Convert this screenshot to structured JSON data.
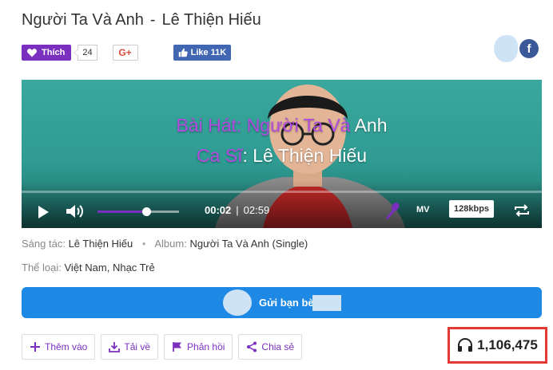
{
  "song": {
    "title": "Người Ta Và Anh",
    "separator": "-",
    "artist": "Lê Thiện Hiếu"
  },
  "social": {
    "like_label": "Thích",
    "like_count": "24",
    "gplus_label": "G+",
    "fb_like_label": "Like 11K",
    "fb_icon": "f"
  },
  "player": {
    "lyric_line1_highlight": "Bài Hát: Người Ta Và",
    "lyric_line1_rest": " Anh",
    "lyric_line2_highlight": "Ca Sĩ",
    "lyric_line2_rest": ": Lê Thiện Hiếu",
    "current_time": "00:02",
    "time_separator": "|",
    "duration": "02:59",
    "mv_label": "MV",
    "quality_label": "128kbps",
    "volume_level": 0.6,
    "progress": 0.01
  },
  "meta": {
    "composer_label": "Sáng tác:",
    "composer_value": "Lê Thiện Hiếu",
    "album_label": "Album:",
    "album_value": "Người Ta Và Anh (Single)",
    "genre_label": "Thể loại:",
    "genre_value": "Việt Nam, Nhạc Trẻ"
  },
  "send_button": {
    "label": "Gửi bạn bè"
  },
  "bottom_actions": {
    "add_label": "Thêm vào",
    "download_label": "Tải về",
    "feedback_label": "Phản hồi",
    "share_label": "Chia sẻ"
  },
  "listens": {
    "count": "1,106,475"
  },
  "colors": {
    "accent_purple": "#7b2fbe",
    "send_blue": "#1e88e5",
    "highlight_red": "#e53935",
    "facebook_blue": "#3b5998"
  }
}
